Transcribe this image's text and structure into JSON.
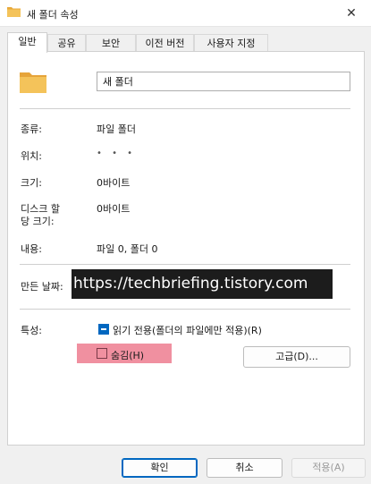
{
  "window": {
    "title": "새 폴더 속성",
    "close_symbol": "✕"
  },
  "tabs": [
    {
      "label": "일반",
      "active": true
    },
    {
      "label": "공유"
    },
    {
      "label": "보안"
    },
    {
      "label": "이전 버전"
    },
    {
      "label": "사용자 지정"
    }
  ],
  "general": {
    "folder_name": "새 폴더",
    "type_label": "종류:",
    "type_value": "파일 폴더",
    "location_label": "위치:",
    "location_value": "• • •",
    "size_label": "크기:",
    "size_value": "0바이트",
    "disk_size_label_line1": "디스크 할",
    "disk_size_label_line2": "당 크기:",
    "disk_size_value": "0바이트",
    "contents_label": "내용:",
    "contents_value": "파일 0, 폴더 0",
    "created_label": "만든 날짜:",
    "created_overlay": "https://techbriefing.tistory.com",
    "attributes_label": "특성:",
    "readonly_label": "읽기 전용(폴더의 파일에만 적용)(R)",
    "hidden_label": "숨김(H)",
    "advanced_button": "고급(D)..."
  },
  "footer": {
    "ok": "확인",
    "cancel": "취소",
    "apply": "적용(A)"
  },
  "colors": {
    "accent": "#0067c0",
    "highlight": "#f090a0",
    "folder": "#f4c35a"
  }
}
